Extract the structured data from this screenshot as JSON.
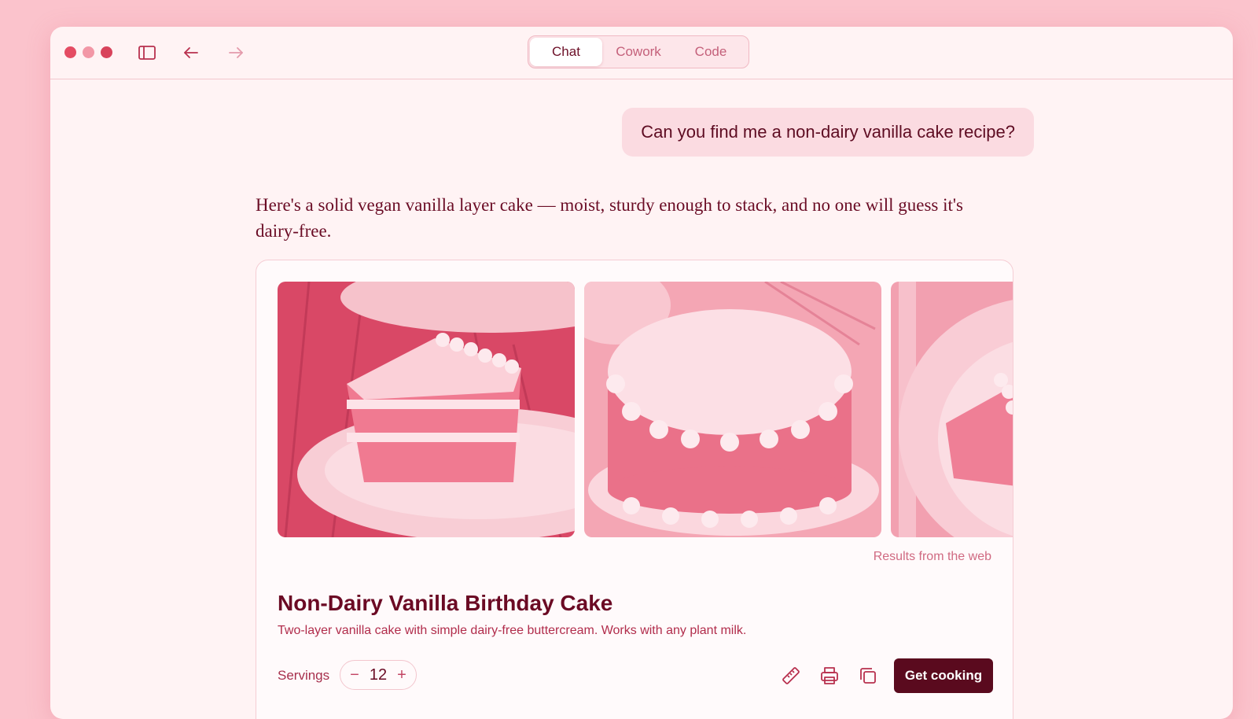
{
  "titlebar": {
    "tabs": [
      "Chat",
      "Cowork",
      "Code"
    ],
    "active_tab": "Chat",
    "icons": [
      "sidebar-toggle-icon",
      "back-arrow-icon",
      "forward-arrow-icon"
    ]
  },
  "chat": {
    "user_message": "Can you find me a non-dairy vanilla cake recipe?",
    "assistant_message": "Here's a solid vegan vanilla layer cake — moist, sturdy enough to stack, and no one will guess it's dairy-free."
  },
  "recipe": {
    "source_note": "Results from the web",
    "title": "Non-Dairy Vanilla Birthday Cake",
    "description": "Two-layer vanilla cake with simple dairy-free buttercream. Works with any plant milk.",
    "servings_label": "Servings",
    "servings_value": "12",
    "decrement": "−",
    "increment": "+",
    "action_icons": [
      "ruler-icon",
      "print-icon",
      "copy-icon"
    ],
    "cta_label": "Get cooking"
  },
  "colors": {
    "background": "#fbc3cc",
    "window": "#fff3f4",
    "accent": "#5a0a1e",
    "text": "#6a0c25"
  }
}
